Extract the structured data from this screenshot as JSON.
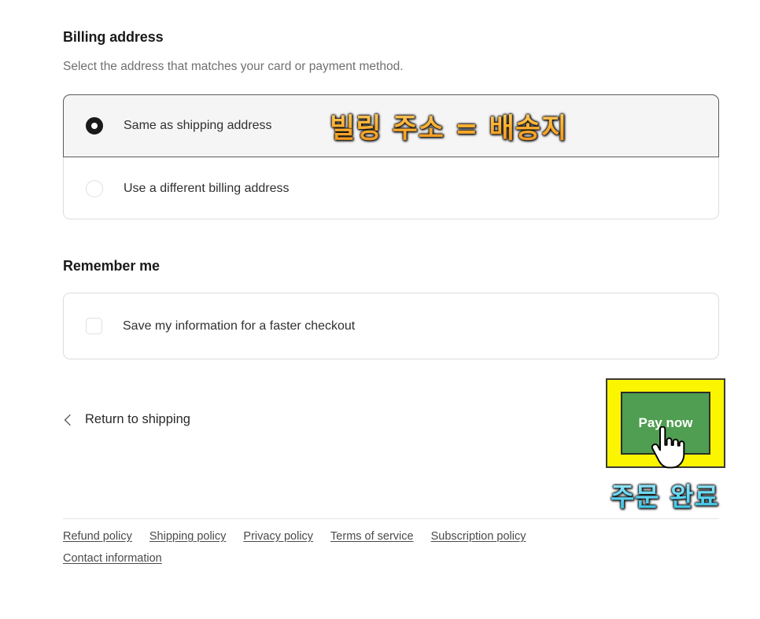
{
  "billing": {
    "title": "Billing address",
    "subtitle": "Select the address that matches your card or payment method.",
    "options": [
      {
        "label": "Same as shipping address",
        "selected": true
      },
      {
        "label": "Use a different billing address",
        "selected": false
      }
    ]
  },
  "remember": {
    "title": "Remember me",
    "checkbox_label": "Save my information for a faster checkout",
    "checked": false
  },
  "actions": {
    "return_label": "Return to shipping",
    "pay_label": "Pay now"
  },
  "footer": {
    "links": [
      "Refund policy",
      "Shipping policy",
      "Privacy policy",
      "Terms of service",
      "Subscription policy",
      "Contact information"
    ]
  },
  "annotations": {
    "billing_note": "빌링 주소 = 배송지",
    "order_note": "주문 완료"
  },
  "colors": {
    "pay_button_green": "#4f9e51",
    "highlight_yellow": "#fbf500",
    "annotation_orange": "#fcb234",
    "annotation_cyan": "#63d7f4",
    "selected_row_bg": "#f5f5f5",
    "card_border": "#dcdcdc"
  }
}
